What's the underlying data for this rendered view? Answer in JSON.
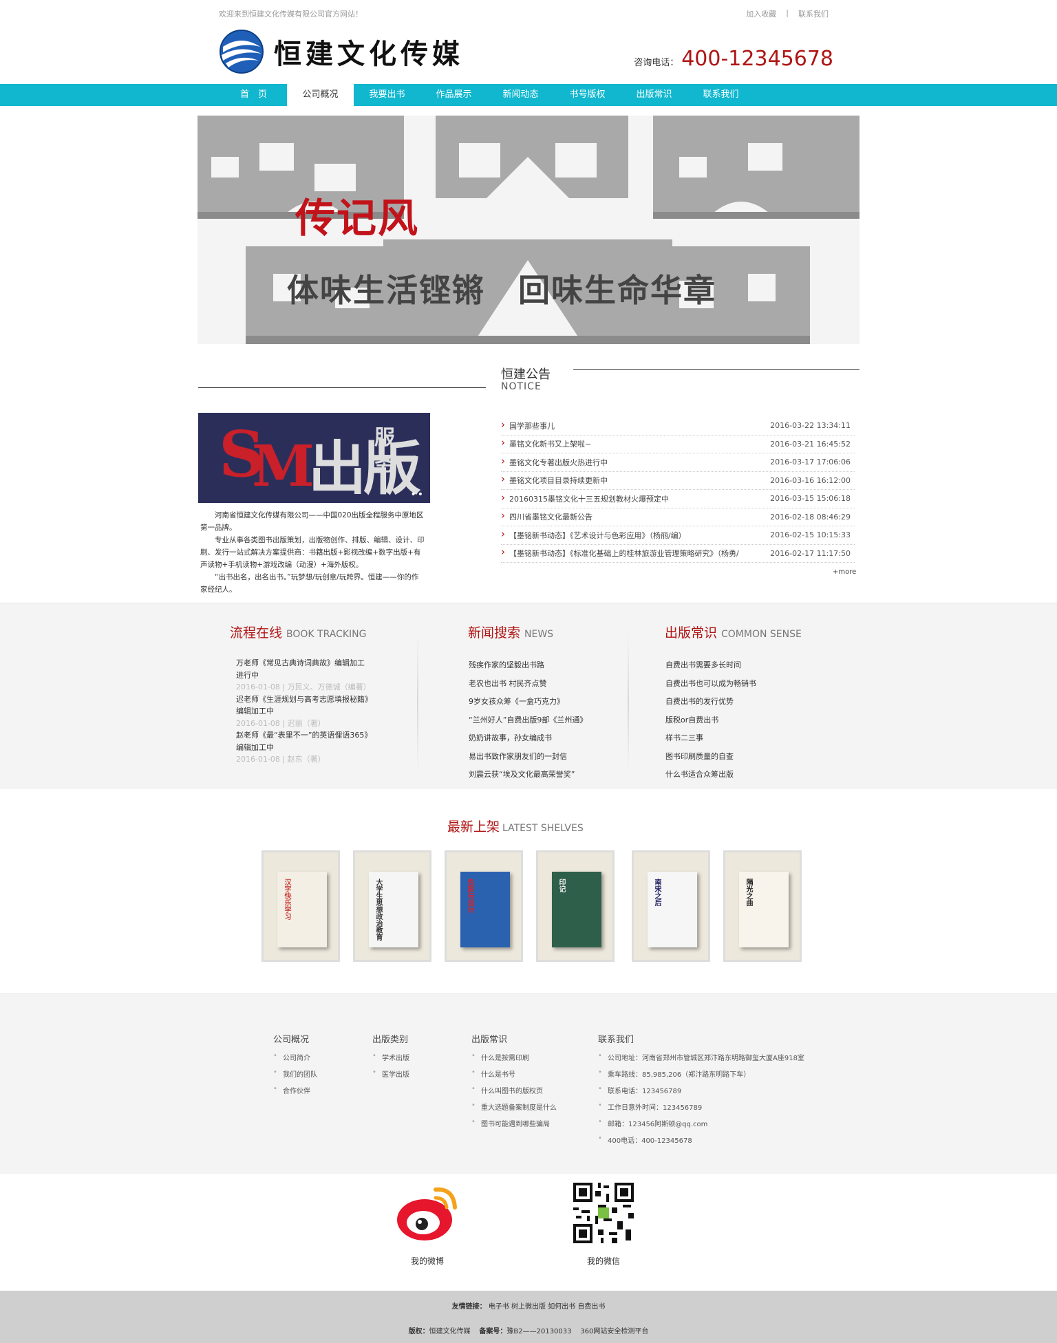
{
  "topbar": {
    "welcome": "欢迎来到恒建文化传媒有限公司官方网站！",
    "add_favorite": "加入收藏",
    "separator": "|",
    "contact": "联系我们"
  },
  "header": {
    "logo_text": "恒建文化传媒",
    "hotline_label": "咨询电话：",
    "hotline_number": "400-12345678"
  },
  "nav": {
    "items": [
      {
        "label": "首　页"
      },
      {
        "label": "公司概况"
      },
      {
        "label": "我要出书"
      },
      {
        "label": "作品展示"
      },
      {
        "label": "新闻动态"
      },
      {
        "label": "书号版权"
      },
      {
        "label": "出版常识"
      },
      {
        "label": "联系我们"
      }
    ],
    "active_index": 1
  },
  "banner": {
    "title": "传记风",
    "slogan": "体味生活铿锵　回味生命华章"
  },
  "notice": {
    "title": "恒建公告",
    "subtitle": "NOTICE",
    "image": {
      "s": "S",
      "m": "M",
      "cb": "出版",
      "fw": "服务",
      "dots": "••"
    },
    "intro": [
      "河南省恒建文化传媒有限公司——中国020出版全程服务中原地区第一品牌。",
      "专业从事各类图书出版策划，出版物创作、排版、编辑、设计、印刷、发行一站式解决方案提供商：书籍出版+影视改编+数字出版+有声读物+手机读物+游戏改编（动漫）+海外版权。",
      "“出书出名，出名出书。”玩梦想/玩创意/玩跨界。恒建——你的作家经纪人。"
    ],
    "items": [
      {
        "title": "国学那些事儿",
        "date": "2016-03-22 13:34:11"
      },
      {
        "title": "墨铭文化新书又上架啦~",
        "date": "2016-03-21 16:45:52"
      },
      {
        "title": "墨铭文化专著出版火热进行中",
        "date": "2016-03-17 17:06:06"
      },
      {
        "title": "墨铭文化项目目录持续更新中",
        "date": "2016-03-16 16:12:00"
      },
      {
        "title": "20160315墨铭文化十三五规划教材火爆预定中",
        "date": "2016-03-15 15:06:18"
      },
      {
        "title": "四川省墨铭文化最新公告",
        "date": "2016-02-18 08:46:29"
      },
      {
        "title": "【墨铭新书动态】《艺术设计与色彩应用》（杨丽/编）",
        "date": "2016-02-15 10:15:33"
      },
      {
        "title": "【墨铭新书动态】《标准化基础上的桂林旅游业管理策略研究》（杨勇/",
        "date": "2016-02-17 11:17:50"
      }
    ],
    "more": "+more"
  },
  "tracking": {
    "title": "流程在线",
    "title_en": "BOOK TRACKING",
    "items": [
      {
        "text": "万老师《常见古典诗词典故》编辑加工进行中",
        "meta": "2016-01-08 | 万民义、万德诚（编著）"
      },
      {
        "text": "迟老师《生涯规划与高考志愿填报秘籍》编辑加工中",
        "meta": "2016-01-08 | 迟丽（著）"
      },
      {
        "text": "赵老师《最“表里不一”的英语俚语365》编辑加工中",
        "meta": "2016-01-08 | 赵东（著）"
      }
    ]
  },
  "news": {
    "title": "新闻搜索",
    "title_en": "NEWS",
    "items": [
      "残疾作家的坚毅出书路",
      "老农也出书 村民齐点赞",
      "9岁女孩众筹《一盒巧克力》",
      "“兰州好人”自费出版9部《兰州通》",
      "奶奶讲故事，孙女编成书",
      "易出书致作家朋友们的一封信",
      "刘震云获“埃及文化最高荣誉奖”"
    ]
  },
  "sense": {
    "title": "出版常识",
    "title_en": "COMMON SENSE",
    "items": [
      "自费出书需要多长时间",
      "自费出书也可以成为畅销书",
      "自费出书的发行优势",
      "版税or自费出书",
      "样书二三事",
      "图书印刷质量的自查",
      "什么书适合众筹出版"
    ]
  },
  "shelves": {
    "title": "最新上架",
    "title_en": "LATEST SHELVES",
    "books": [
      {
        "cover_title": "汉字快乐学习",
        "bg": "#f3efe4",
        "fg": "#c44"
      },
      {
        "cover_title": "大学生思想政治教育",
        "bg": "#f5f5f5",
        "fg": "#333"
      },
      {
        "cover_title": "色彩与设计",
        "bg": "#2a62b0",
        "fg": "#e02020"
      },
      {
        "cover_title": "印记",
        "bg": "#2e5f4a",
        "fg": "#eee"
      },
      {
        "cover_title": "南宋之后",
        "bg": "#f6f6f6",
        "fg": "#226"
      },
      {
        "cover_title": "隔光之曲",
        "bg": "#f8f4ec",
        "fg": "#222"
      }
    ]
  },
  "footer": {
    "col1": {
      "title": "公司概况",
      "items": [
        "公司简介",
        "我们的团队",
        "合作伙伴"
      ]
    },
    "col2": {
      "title": "出版类别",
      "items": [
        "学术出版",
        "医学出版"
      ]
    },
    "col3": {
      "title": "出版常识",
      "items": [
        "什么是按需印刷",
        "什么是书号",
        "什么叫图书的版权页",
        "重大选题备案制度是什么",
        "图书可能遇到哪些骗局"
      ]
    },
    "col4": {
      "title": "联系我们",
      "items": [
        "公司地址：河南省郑州市管城区郑汴路东明路御玺大厦A座918室",
        "乘车路线：85,985,206（郑汴路东明路下车）",
        "联系电话：123456789",
        "工作日意外时间：123456789",
        "邮箱：123456阿斯顿@qq.com",
        "400电话：400-12345678"
      ]
    },
    "weibo_label": "我的微博",
    "wechat_label": "我的微信"
  },
  "bottom": {
    "links_label": "友情链接：",
    "links": [
      "电子书",
      "树上微出版",
      "如何出书",
      "自费出书"
    ],
    "copyright_label": "版权：",
    "copyright": "恒建文化传媒",
    "icp_label": "备案号：",
    "icp": "豫B2——20130033",
    "security": "360网站安全检测平台"
  },
  "colors": {
    "nav_bg": "#10b7cf",
    "accent_red": "#b01515"
  }
}
